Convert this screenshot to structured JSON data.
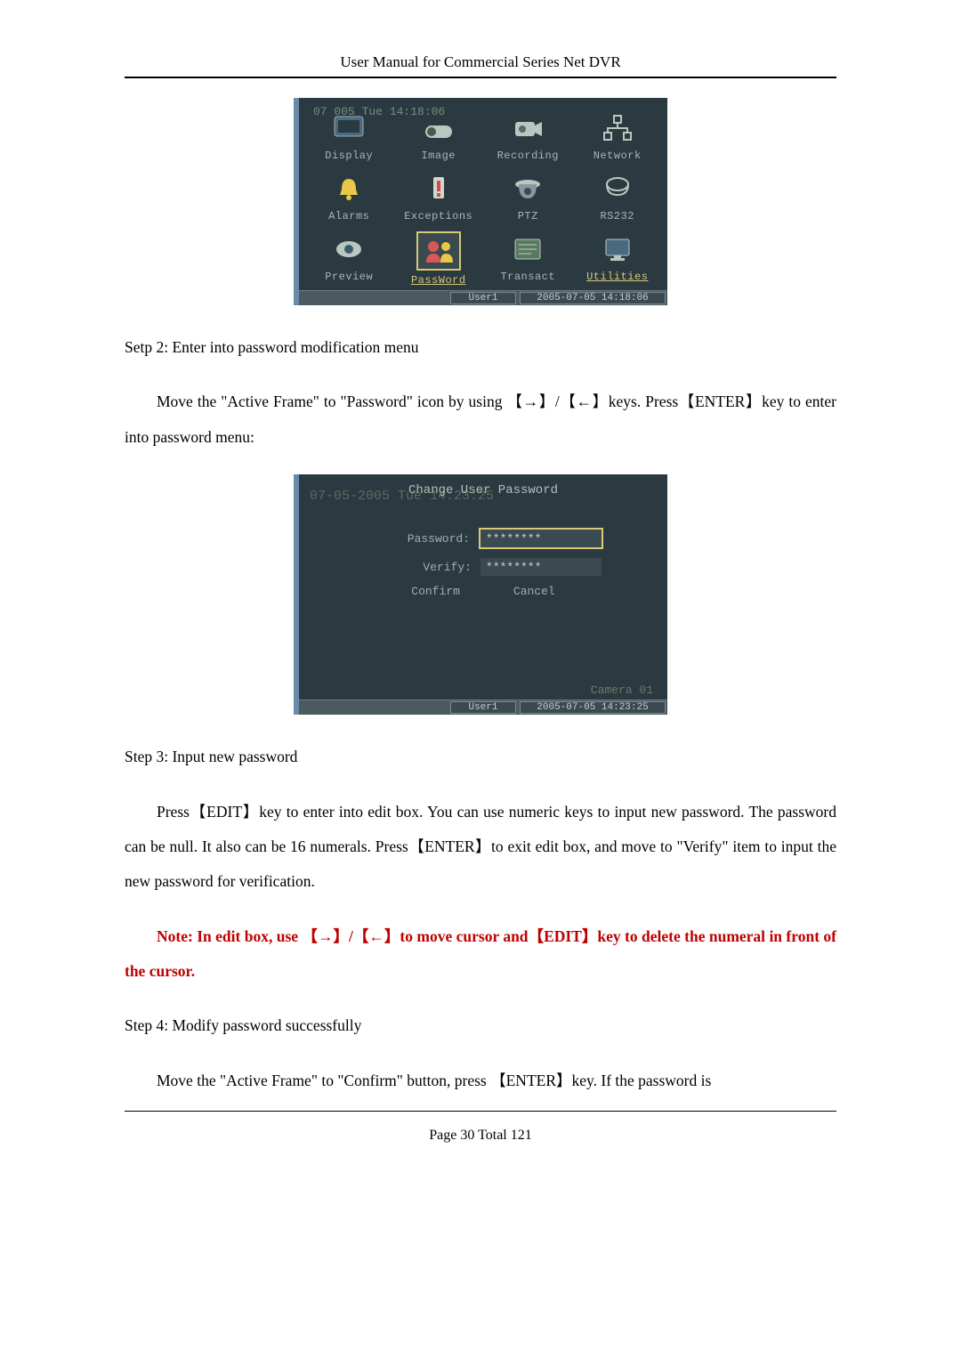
{
  "header": {
    "title": "User Manual for Commercial Series Net DVR"
  },
  "screenshot1": {
    "timestamp_overlay": "07    005  Tue  14:18:06",
    "menu": [
      {
        "label": "Display",
        "icon": "display-icon"
      },
      {
        "label": "Image",
        "icon": "image-icon"
      },
      {
        "label": "Recording",
        "icon": "camcorder-icon"
      },
      {
        "label": "Network",
        "icon": "network-icon"
      },
      {
        "label": "Alarms",
        "icon": "bell-icon"
      },
      {
        "label": "Exceptions",
        "icon": "warning-icon"
      },
      {
        "label": "PTZ",
        "icon": "dome-icon"
      },
      {
        "label": "RS232",
        "icon": "serial-icon"
      },
      {
        "label": "Preview",
        "icon": "eye-icon"
      },
      {
        "label": "PassWord",
        "icon": "user-pass-icon",
        "selected": true
      },
      {
        "label": "Transact",
        "icon": "transact-icon"
      },
      {
        "label": "Utilities",
        "icon": "monitor-icon"
      }
    ],
    "status": {
      "user": "User1",
      "timestamp": "2005-07-05 14:18:06"
    }
  },
  "step2": {
    "title": "Setp 2: Enter into password modification menu",
    "text": "Move the \"Active Frame\" to \"Password\" icon by using 【→】/【←】keys. Press【ENTER】key to enter into password menu:"
  },
  "screenshot2": {
    "title": "Change User Password",
    "timestamp_overlay": "07-05-2005  Tue 14:23:25",
    "password_label": "Password:",
    "password_value": "********",
    "verify_label": "Verify:",
    "verify_value": "********",
    "confirm": "Confirm",
    "cancel": "Cancel",
    "camera": "Camera 01",
    "status": {
      "user": "User1",
      "timestamp": "2005-07-05 14:23:25"
    }
  },
  "step3": {
    "title": "Step 3: Input new password",
    "text1": "Press【EDIT】key to enter into edit box. You can use numeric keys to input new password. The password can be null. It also can be 16 numerals. Press【ENTER】to exit edit box, and move to \"Verify\" item to input the new password for verification.",
    "note": "Note: In edit box, use 【→】/【←】to move cursor and【EDIT】key to delete the numeral in front of the cursor."
  },
  "step4": {
    "title": "Step 4: Modify password successfully",
    "text": "Move the \"Active Frame\" to \"Confirm\" button, press 【ENTER】key. If the password is"
  },
  "footer": {
    "page_prefix": "Page ",
    "page_num": "30",
    "total_prefix": " Total ",
    "page_total": "121"
  }
}
